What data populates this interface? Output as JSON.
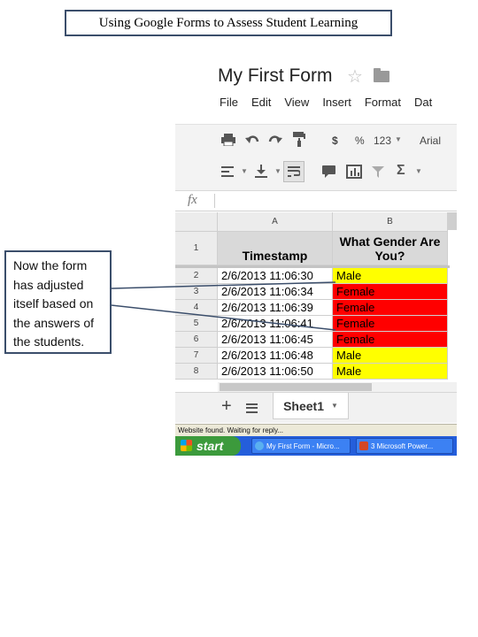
{
  "slide": {
    "title": "Using Google Forms to Assess Student Learning",
    "callout": "Now the form\nhas adjusted\nitself based on\nthe answers of\nthe students."
  },
  "app": {
    "doc_title": "My First Form",
    "star_icon": "star-icon",
    "folder_icon": "folder-icon",
    "menu": [
      "File",
      "Edit",
      "View",
      "Insert",
      "Format",
      "Dat"
    ],
    "toolbar": {
      "currency": "$",
      "percent": "%",
      "number_format": "123",
      "font": "Arial",
      "icons": [
        "print-icon",
        "undo-icon",
        "redo-icon",
        "paint-format-icon",
        "align-left-icon",
        "valign-bottom-icon",
        "wrap-text-icon",
        "comment-icon",
        "chart-icon",
        "filter-icon",
        "sum-icon"
      ]
    },
    "formula_bar": {
      "fx": "fx",
      "value": ""
    },
    "columns": [
      "A",
      "B"
    ],
    "header_row": {
      "num": "1",
      "a": "Timestamp",
      "b": "What Gender Are You?"
    },
    "rows": [
      {
        "num": "2",
        "timestamp": "2/6/2013 11:06:30",
        "gender": "Male"
      },
      {
        "num": "3",
        "timestamp": "2/6/2013 11:06:34",
        "gender": "Female"
      },
      {
        "num": "4",
        "timestamp": "2/6/2013 11:06:39",
        "gender": "Female"
      },
      {
        "num": "5",
        "timestamp": "2/6/2013 11:06:41",
        "gender": "Female"
      },
      {
        "num": "6",
        "timestamp": "2/6/2013 11:06:45",
        "gender": "Female"
      },
      {
        "num": "7",
        "timestamp": "2/6/2013 11:06:48",
        "gender": "Male"
      },
      {
        "num": "8",
        "timestamp": "2/6/2013 11:06:50",
        "gender": "Male"
      }
    ],
    "colors": {
      "male": "#ffff00",
      "female": "#ff0000"
    },
    "sheet_tab": "Sheet1",
    "status": "Website found. Waiting for reply...",
    "taskbar": {
      "start": "start",
      "tasks": [
        "My First Form - Micro...",
        "3 Microsoft Power..."
      ]
    }
  }
}
